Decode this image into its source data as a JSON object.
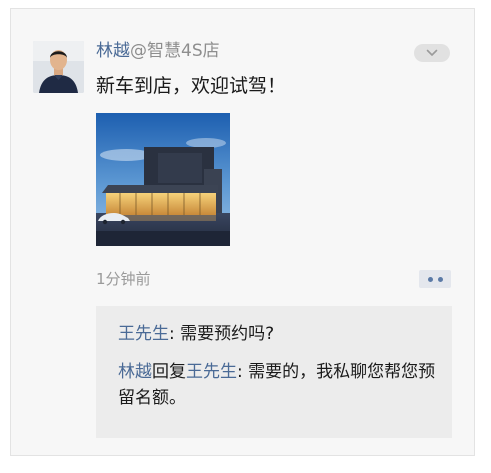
{
  "post": {
    "author_name": "林越",
    "author_handle": "@智慧4S店",
    "text": "新车到店，欢迎试驾！",
    "timestamp": "1分钟前"
  },
  "comments": [
    {
      "author": "王先生",
      "separator": ": ",
      "text": "需要预约吗?"
    },
    {
      "author": "林越",
      "reply_word": "回复",
      "reply_to": "王先生",
      "separator": ": ",
      "text": "需要的，我私聊您帮您预留名额。"
    }
  ],
  "colors": {
    "link": "#4a6a96",
    "card_bg": "#f7f7f7",
    "comment_bg": "#ececec",
    "timestamp": "#9a9a9a"
  },
  "icons": {
    "menu": "chevron-down-icon",
    "comment": "comment-dots-icon"
  }
}
